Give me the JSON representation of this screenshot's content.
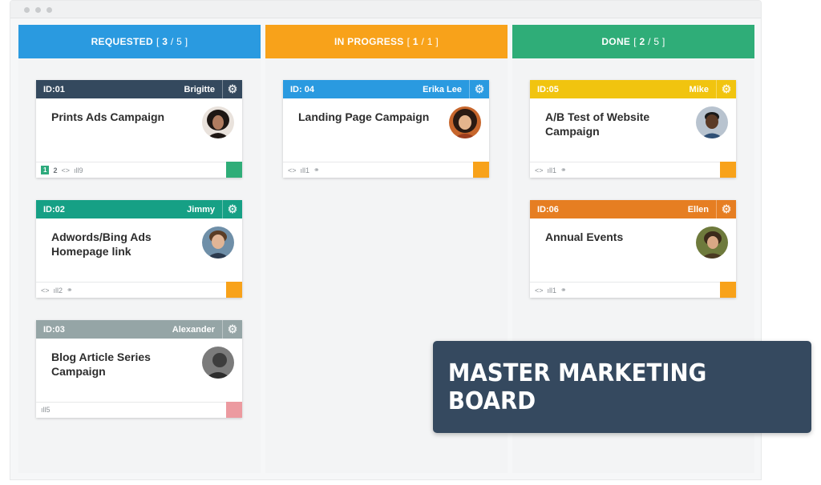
{
  "columns": [
    {
      "title": "REQUESTED",
      "count_current": "3",
      "count_total": "5",
      "color": "#2a9ae0"
    },
    {
      "title": "IN PROGRESS",
      "count_current": "1",
      "count_total": "1",
      "color": "#f8a21a"
    },
    {
      "title": "DONE",
      "count_current": "2",
      "count_total": "5",
      "color": "#2fad78"
    }
  ],
  "cards": [
    {
      "id": "ID:01",
      "user": "Brigitte",
      "title": "Prints Ads Campaign",
      "header_color": "#34495e",
      "badge": "1",
      "badge_count": "2",
      "stat": "9",
      "link": false,
      "swatch": "#2fad78",
      "avatar": "woman-curly-hair-avatar"
    },
    {
      "id": "ID:02",
      "user": "Jimmy",
      "title": "Adwords/Bing Ads Homepage link",
      "header_color": "#16a085",
      "badge": "",
      "badge_count": "",
      "stat": "2",
      "link": true,
      "swatch": "#f8a21a",
      "avatar": "man-smiling-avatar"
    },
    {
      "id": "ID:03",
      "user": "Alexander",
      "title": "Blog Article Series Campaign",
      "header_color": "#95a5a6",
      "badge": "",
      "badge_count": "",
      "stat": "5",
      "link": false,
      "swatch": "#ec9aa0",
      "avatar": "grayscale-photo-avatar"
    },
    {
      "id": "ID: 04",
      "user": "Erika Lee",
      "title": "Landing Page Campaign",
      "header_color": "#2a9ae0",
      "badge": "",
      "badge_count": "",
      "stat": "1",
      "link": true,
      "swatch": "#f8a21a",
      "avatar": "woman-long-hair-avatar"
    },
    {
      "id": "ID:05",
      "user": "Mike",
      "title": "A/B Test of Website Campaign",
      "header_color": "#f1c40f",
      "badge": "",
      "badge_count": "",
      "stat": "1",
      "link": true,
      "swatch": "#f8a21a",
      "avatar": "man-glasses-avatar"
    },
    {
      "id": "ID:06",
      "user": "Ellen",
      "title": "Annual Events",
      "header_color": "#e67e22",
      "badge": "",
      "badge_count": "",
      "stat": "1",
      "link": true,
      "swatch": "#f8a21a",
      "avatar": "woman-outdoor-avatar"
    }
  ],
  "banner": {
    "text": "MASTER MARKETING BOARD"
  }
}
